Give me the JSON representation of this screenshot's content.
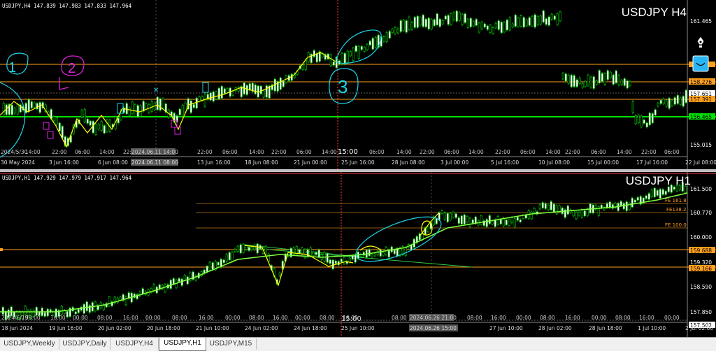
{
  "h4": {
    "ohlc": "USDJPY,H4  147.839 147.983 147.833 147.964",
    "title": "USDJPY H4",
    "price_labels": [
      "161.465",
      "158.276",
      "157.651",
      "157.391",
      "156.465",
      "155.015"
    ],
    "date_labels": [
      "30 May 2024",
      "3 Jun 16:00",
      "6 Jun 08:00",
      "2024.06.11 08:00",
      "13 Jun 16:00",
      "18 Jun 08:00",
      "21 Jun 00:00",
      "25 Jun 16:00",
      "28 Jun 08:00",
      "3 Jul 00:00",
      "5 Jul 16:00",
      "10 Jul 08:00",
      "15 Jul 00:00",
      "17 Jul 16:00",
      "22 Jul 08:00"
    ],
    "time_labels": [
      "2024/5/30",
      "14:00",
      "22:00",
      "06:00",
      "14:00",
      "22:00",
      "2024.06.11 14:00",
      "22:00",
      "06:00",
      "14:00",
      "22:00",
      "06:00",
      "14:00",
      "15:00",
      "06:00",
      "14:00",
      "22:00",
      "06:00",
      "14:00",
      "22:00",
      "06:00",
      "14:00",
      "22:00",
      "06:00",
      "14:00",
      "22:00",
      "06:00"
    ],
    "annotations": [
      "1",
      "2",
      "3"
    ],
    "colors": {
      "orange": "#ff9f1c",
      "green": "#00e000",
      "yellow": "#ffff00",
      "cyan": "#1ed3e6",
      "magenta": "#e020e0",
      "red": "#ff3b3b"
    }
  },
  "h1": {
    "ohlc": "USDJPY,H1  147.929 147.979 147.917 147.964",
    "title": "USDJPY H1",
    "price_labels": [
      "161.500",
      "160.770",
      "160.000",
      "159.688",
      "159.320",
      "159.166",
      "158.590",
      "157.850",
      "157.502"
    ],
    "fib_labels": [
      "FE 161.8",
      "FE138.2",
      "FE 100.0"
    ],
    "date_labels": [
      "18 Jun 2024",
      "19 Jun 16:00",
      "20 Jun 02:00",
      "20 Jun 18:00",
      "21 Jun 10:00",
      "24 Jun 02:00",
      "24 Jun 18:00",
      "25 Jun 10:00",
      "2024.06.26 15:00",
      "27 Jun 10:00",
      "28 Jun 02:00",
      "28 Jun 18:00",
      "1 Jul 10:00",
      "2 Jul 02:00"
    ],
    "time_labels": [
      "2024/6/19",
      "08:00",
      "16:00",
      "00:00",
      "08:00",
      "16:00",
      "00:00",
      "08:00",
      "16:00",
      "00:00",
      "08:00",
      "16:00",
      "00:00",
      "08:00",
      "16:00",
      "15:00",
      "08:00",
      "2024.06.26 21:00",
      "08:00",
      "16:00",
      "00:00",
      "08:00",
      "16:00",
      "00:00",
      "08:00",
      "16:00",
      "00:00"
    ]
  },
  "tabs": [
    "USDJPY,Weekly",
    "USDJPY,Daily",
    "USDJPY,H4",
    "USDJPY,H1",
    "USDJPY,M15"
  ],
  "active_tab": "USDJPY,H1"
}
